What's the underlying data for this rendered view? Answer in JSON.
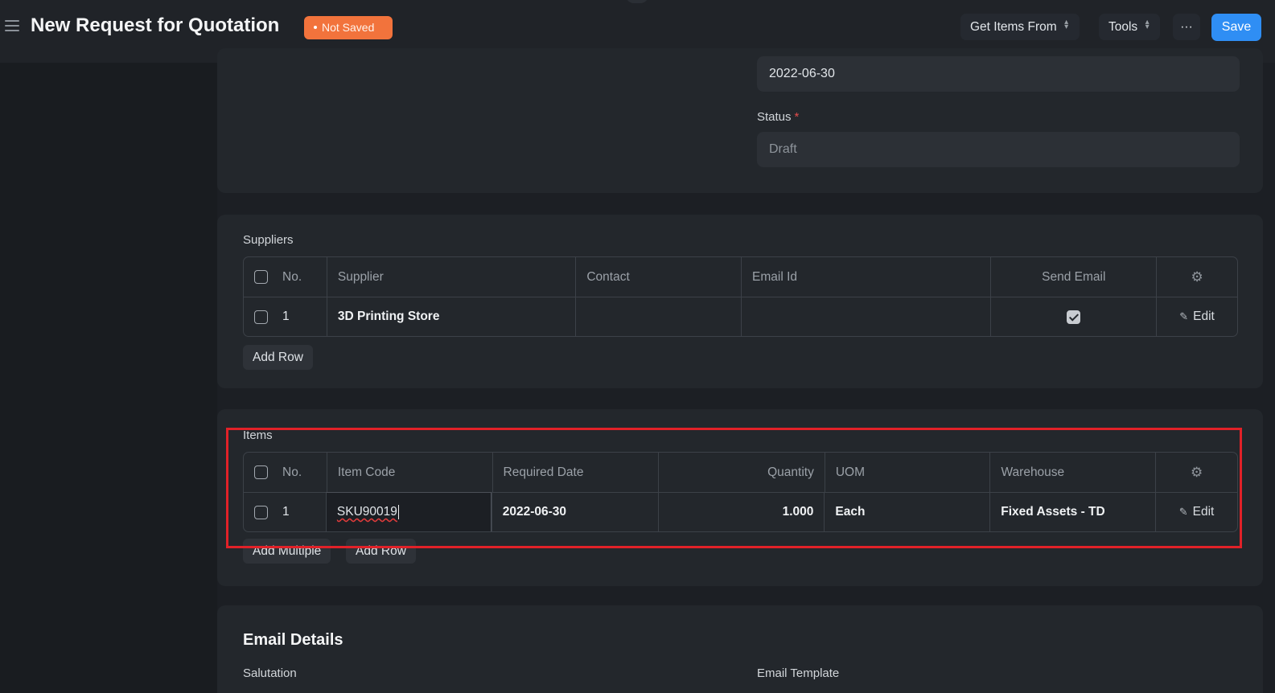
{
  "header": {
    "title": "New Request for Quotation",
    "status_badge": "Not Saved",
    "get_items_label": "Get Items From",
    "tools_label": "Tools",
    "more_label": "···",
    "save_label": "Save"
  },
  "form": {
    "date_value": "2022-06-30",
    "status_label": "Status",
    "status_required": "*",
    "status_value": "Draft"
  },
  "suppliers": {
    "label": "Suppliers",
    "columns": [
      "No.",
      "Supplier",
      "Contact",
      "Email Id",
      "Send Email"
    ],
    "rows": [
      {
        "no": "1",
        "supplier": "3D Printing Store",
        "contact": "",
        "email_id": "",
        "send_email": true
      }
    ],
    "edit_label": "Edit",
    "add_row_label": "Add Row"
  },
  "items": {
    "label": "Items",
    "columns": [
      "No.",
      "Item Code",
      "Required Date",
      "Quantity",
      "UOM",
      "Warehouse"
    ],
    "rows": [
      {
        "no": "1",
        "item_code": "SKU90019",
        "required_date": "2022-06-30",
        "quantity": "1.000",
        "uom": "Each",
        "warehouse": "Fixed Assets - TD"
      }
    ],
    "edit_label": "Edit",
    "add_multiple_label": "Add Multiple",
    "add_row_label": "Add Row"
  },
  "email_details": {
    "title": "Email Details",
    "salutation_label": "Salutation",
    "email_template_label": "Email Template"
  },
  "colors": {
    "accent": "#2f8ef4",
    "badge": "#f2733c",
    "highlight": "#e12128"
  }
}
